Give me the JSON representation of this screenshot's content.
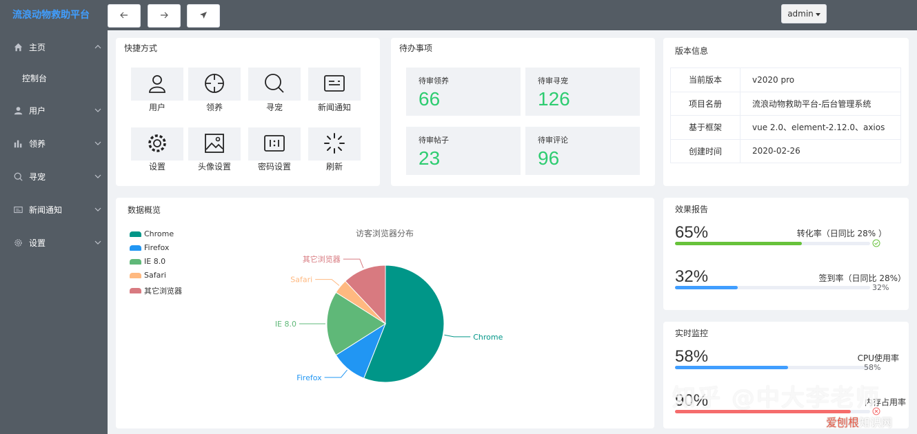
{
  "brand": "流浪动物救助平台",
  "menu": {
    "home": "主页",
    "console": "控制台",
    "user": "用户",
    "adopt": "领养",
    "seek": "寻宠",
    "news": "新闻通知",
    "settings": "设置"
  },
  "header": {
    "admin": "admin"
  },
  "shortcuts": {
    "title": "快捷方式",
    "items": [
      "用户",
      "领养",
      "寻宠",
      "新闻通知",
      "设置",
      "头像设置",
      "密码设置",
      "刷新"
    ]
  },
  "todo": {
    "title": "待办事项",
    "items": [
      {
        "label": "待审领养",
        "value": "66"
      },
      {
        "label": "待审寻宠",
        "value": "126"
      },
      {
        "label": "待审帖子",
        "value": "23"
      },
      {
        "label": "待审评论",
        "value": "96"
      }
    ]
  },
  "version": {
    "title": "版本信息",
    "rows": [
      {
        "k": "当前版本",
        "v": "v2020 pro"
      },
      {
        "k": "项目名册",
        "v": "流浪动物救助平台-后台管理系统"
      },
      {
        "k": "基于框架",
        "v": "vue 2.0、element-2.12.0、axios"
      },
      {
        "k": "创建时间",
        "v": "2020-02-26"
      }
    ]
  },
  "overview": {
    "title": "数据概览"
  },
  "chart_data": {
    "type": "pie",
    "title": "访客浏览器分布",
    "legend_position": "top-left",
    "categories": [
      "Chrome",
      "Firefox",
      "IE 8.0",
      "Safari",
      "其它浏览器"
    ],
    "values": [
      56,
      10,
      18,
      4,
      12
    ],
    "colors": [
      "#009688",
      "#2196f3",
      "#5fb878",
      "#ffb980",
      "#d87a80"
    ]
  },
  "report": {
    "title": "效果报告",
    "items": [
      {
        "pct": "65%",
        "value": 65,
        "label": "转化率（日同比 28% ）",
        "sub": "",
        "color": "#67c23a"
      },
      {
        "pct": "32%",
        "value": 32,
        "label": "签到率（日同比 28%）",
        "sub": "32%",
        "color": "#409eff"
      }
    ]
  },
  "monitor": {
    "title": "实时监控",
    "items": [
      {
        "pct": "58%",
        "value": 58,
        "label": "CPU使用率",
        "sub": "58%",
        "color": "#409eff"
      },
      {
        "pct": "90%",
        "value": 90,
        "label": "内存占用率",
        "sub": "",
        "color": "#f56c6c"
      }
    ]
  },
  "watermark": {
    "main": "知乎 @中大李老师",
    "site_a": "爱刨根",
    "site_b": "知识网"
  }
}
